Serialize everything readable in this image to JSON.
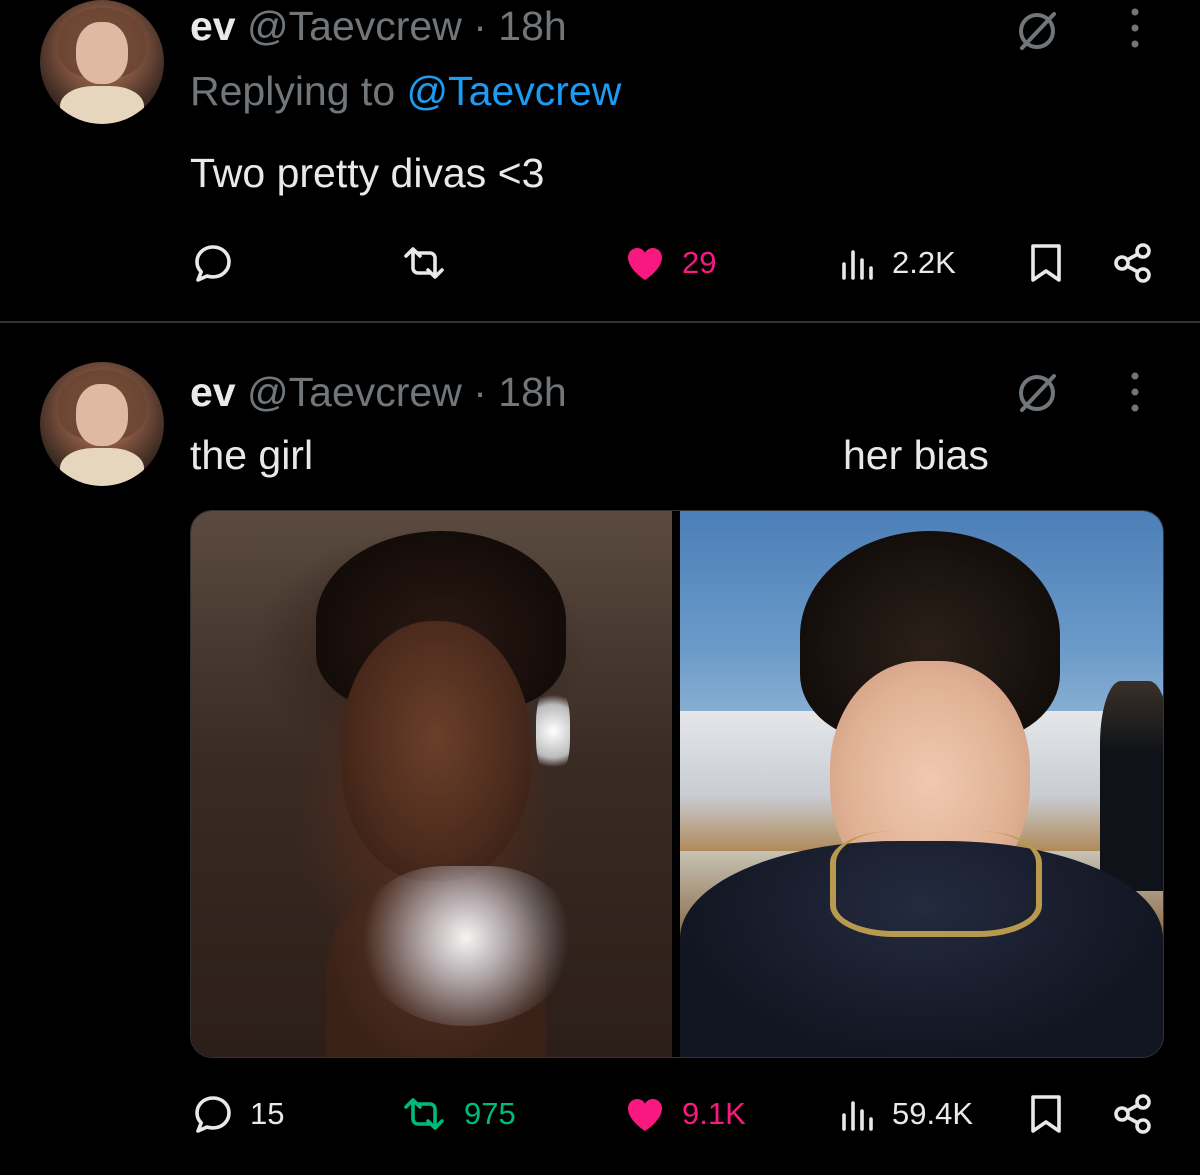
{
  "tweets": [
    {
      "name": "ev",
      "handle": "@Taevcrew",
      "dot": "·",
      "time": "18h",
      "replying_prefix": "Replying to",
      "replying_to": "@Taevcrew",
      "text": "Two pretty divas <3",
      "actions": {
        "reply": "",
        "retweet": "",
        "like": "29",
        "views": "2.2K"
      }
    },
    {
      "name": "ev",
      "handle": "@Taevcrew",
      "dot": "·",
      "time": "18h",
      "caption_left": "the girl",
      "caption_right": "her bias",
      "actions": {
        "reply": "15",
        "retweet": "975",
        "like": "9.1K",
        "views": "59.4K"
      }
    }
  ],
  "icons": {
    "reply": "reply-icon",
    "retweet": "retweet-icon",
    "like": "heart-icon",
    "views": "views-icon",
    "bookmark": "bookmark-icon",
    "share": "share-icon",
    "grok": "grok-icon",
    "more": "more-icon"
  },
  "colors": {
    "background": "#000000",
    "text": "#e7e9ea",
    "muted": "#71767b",
    "link": "#1d9bf0",
    "like": "#f91880",
    "retweet": "#00ba7c"
  }
}
